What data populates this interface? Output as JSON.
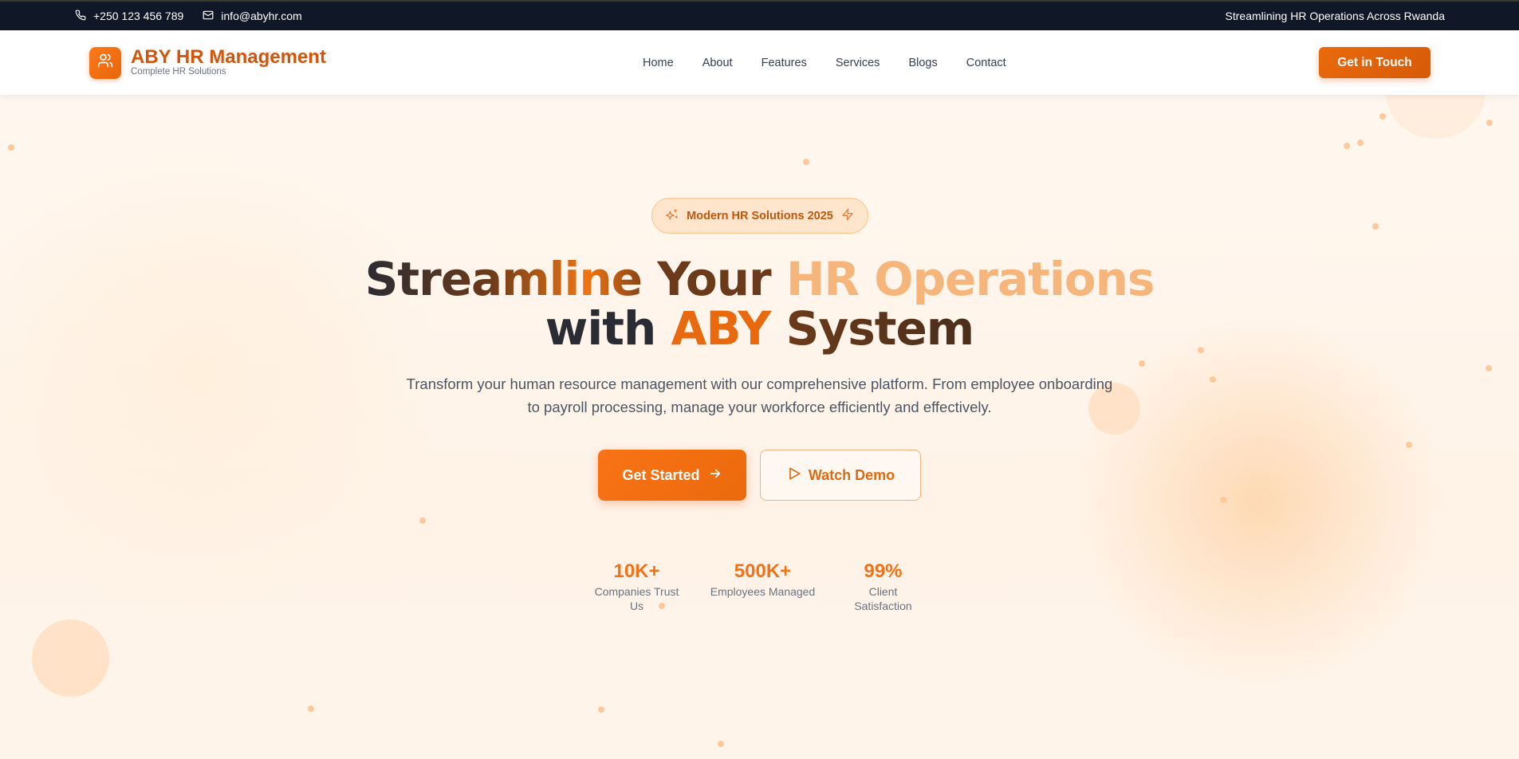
{
  "topbar": {
    "phone": "+250 123 456 789",
    "email": "info@abyhr.com",
    "tagline": "Streamlining HR Operations Across Rwanda"
  },
  "header": {
    "brand_name": "ABY HR Management",
    "brand_tagline": "Complete HR Solutions",
    "nav": [
      "Home",
      "About",
      "Features",
      "Services",
      "Blogs",
      "Contact"
    ],
    "cta": "Get in Touch"
  },
  "hero": {
    "badge": "Modern HR Solutions 2025",
    "headline": {
      "line1_a": "Streamline",
      "line1_b": "Your",
      "line1_c": "HR Operations",
      "line2_a": "with",
      "line2_b": "ABY",
      "line2_c": "System"
    },
    "subtitle": "Transform your human resource management with our comprehensive platform. From employee onboarding to payroll processing, manage your workforce efficiently and effectively.",
    "primary_button": "Get Started",
    "secondary_button": "Watch Demo",
    "stats": [
      {
        "value": "10K+",
        "label": "Companies Trust Us"
      },
      {
        "value": "500K+",
        "label": "Employees Managed"
      },
      {
        "value": "99%",
        "label": "Client Satisfaction"
      }
    ]
  },
  "colors": {
    "accent": "#f97316",
    "accent_dark": "#d4540c",
    "topbar_bg": "#101828"
  },
  "icons": {
    "phone": "phone-icon",
    "email": "mail-icon",
    "logo": "users-icon",
    "badge_left": "sparkles-icon",
    "badge_right": "zap-icon",
    "primary_button": "arrow-right-icon",
    "secondary_button": "play-icon"
  }
}
